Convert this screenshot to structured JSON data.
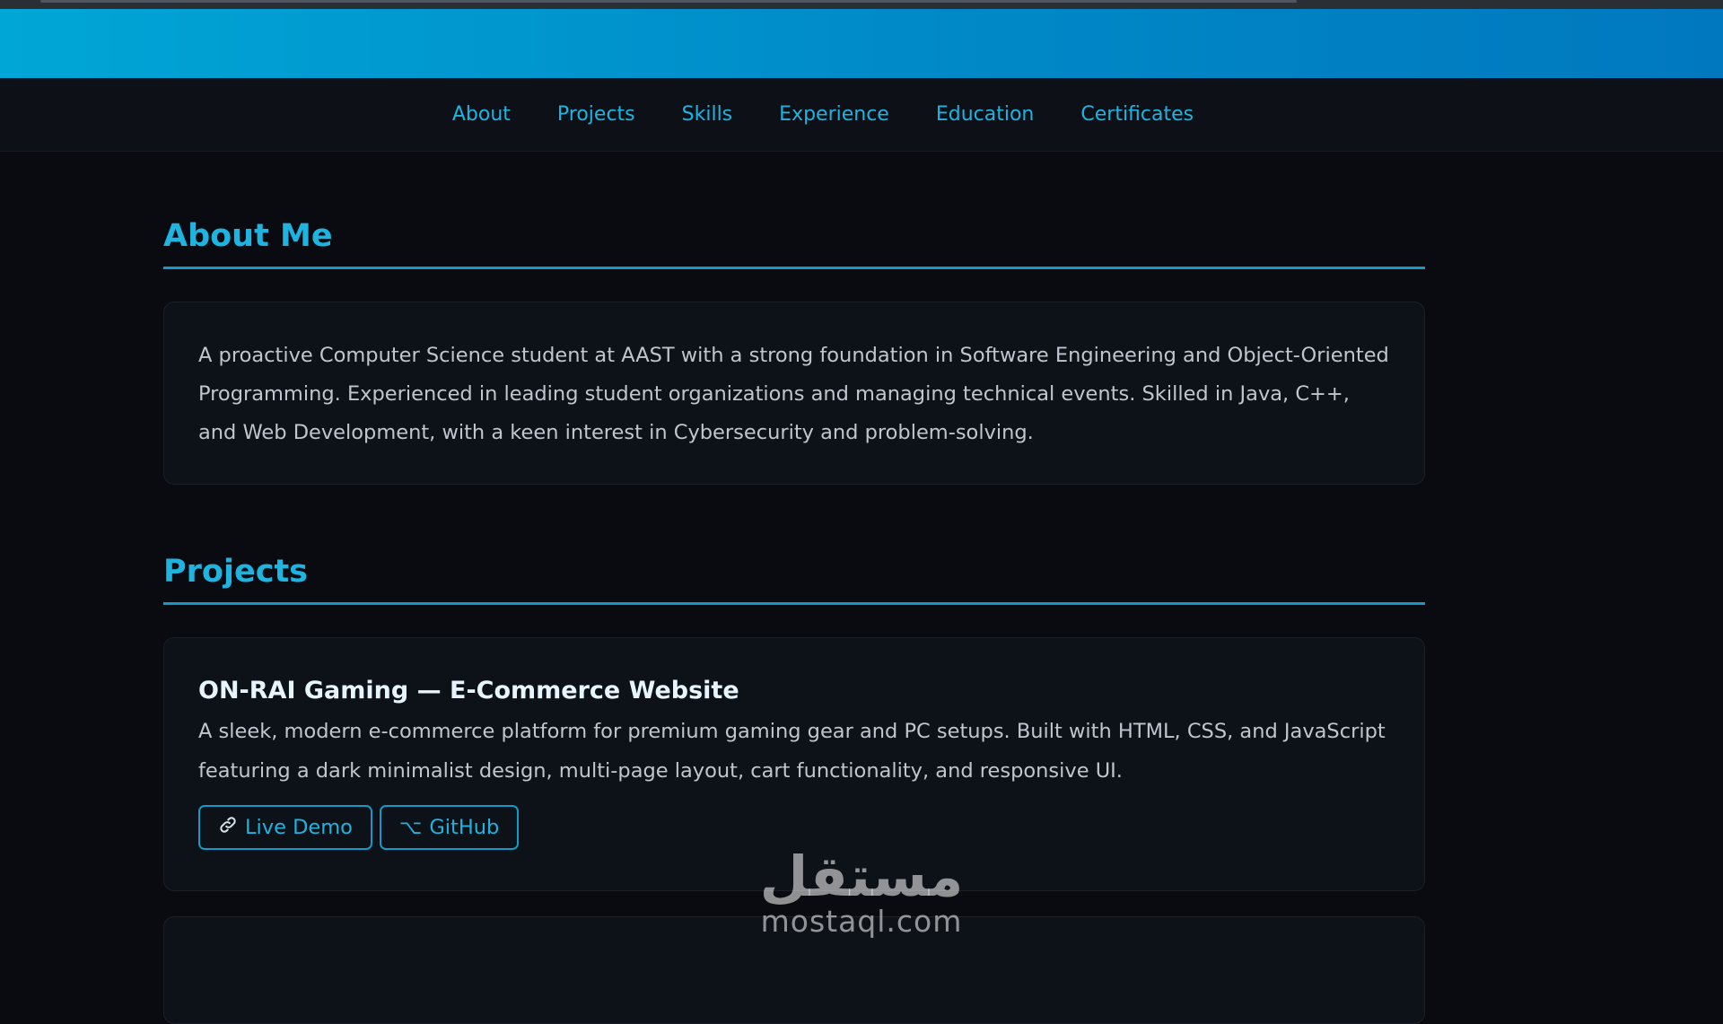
{
  "nav": {
    "items": [
      "About",
      "Projects",
      "Skills",
      "Experience",
      "Education",
      "Certificates"
    ]
  },
  "about": {
    "title": "About Me",
    "text": "A proactive Computer Science student at AAST with a strong foundation in Software Engineering and Object-Oriented Programming. Experienced in leading student organizations and managing technical events. Skilled in Java, C++, and Web Development, with a keen interest in Cybersecurity and problem-solving."
  },
  "projects": {
    "title": "Projects",
    "items": [
      {
        "name": "ON-RAI Gaming — E-Commerce Website",
        "description": "A sleek, modern e-commerce platform for premium gaming gear and PC setups. Built with HTML, CSS, and JavaScript featuring a dark minimalist design, multi-page layout, cart functionality, and responsive UI.",
        "demo_label": "Live Demo",
        "github_label": "GitHub",
        "demo_icon": "link-icon",
        "github_icon": "git-icon"
      }
    ]
  },
  "watermark": {
    "arabic": "مستقل",
    "latin": "mostaql.com"
  },
  "colors": {
    "accent": "#1fb3e0",
    "banner_start": "#00a6d6",
    "banner_end": "#0078bf",
    "background": "#090b10",
    "card": "#0d1118"
  }
}
